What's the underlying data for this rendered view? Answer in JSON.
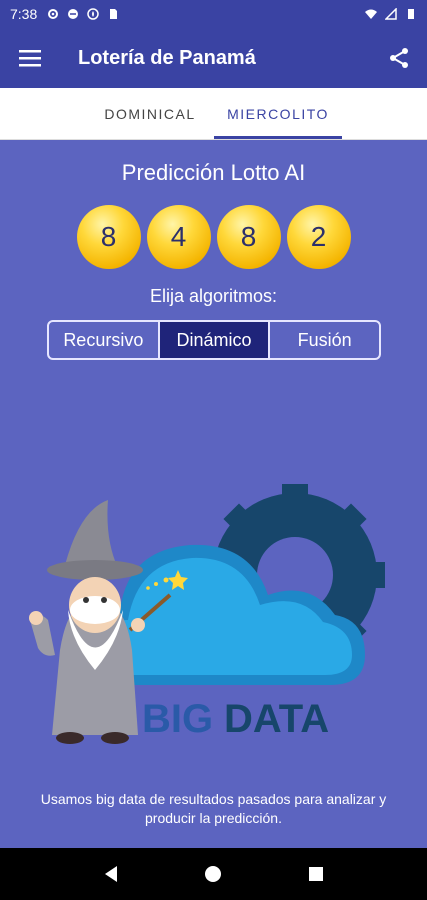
{
  "status": {
    "time": "7:38"
  },
  "app": {
    "title": "Lotería de Panamá"
  },
  "tabs": [
    {
      "label": "DOMINICAL",
      "selected": false
    },
    {
      "label": "MIERCOLITO",
      "selected": true
    }
  ],
  "prediction": {
    "title": "Predicción Lotto AI",
    "numbers": [
      "8",
      "4",
      "8",
      "2"
    ]
  },
  "algorithms": {
    "label": "Elija algoritmos:",
    "options": [
      "Recursivo",
      "Dinámico",
      "Fusión"
    ],
    "selected": "Dinámico"
  },
  "illustration": {
    "logo_text": "BIG DATA"
  },
  "caption": "Usamos big data de resultados pasados para analizar y producir la predicción.",
  "colors": {
    "primary": "#3a43a3",
    "background": "#5c64c0",
    "selected_segment": "#1f247a",
    "ball": "#ffd83a"
  }
}
